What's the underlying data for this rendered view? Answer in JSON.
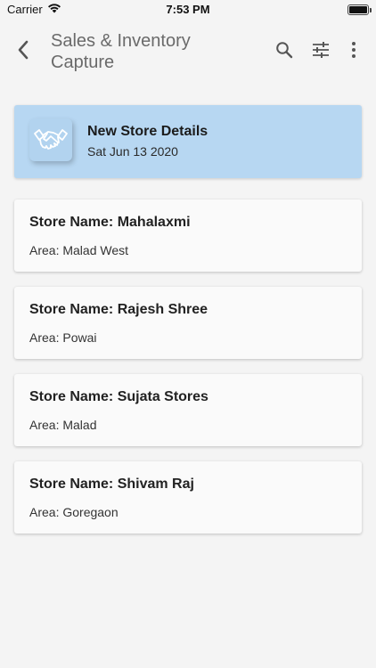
{
  "status_bar": {
    "carrier": "Carrier",
    "time": "7:53 PM",
    "icons": [
      "wifi-icon",
      "battery-icon"
    ]
  },
  "app_bar": {
    "title": "Sales & Inventory Capture",
    "back_icon": "back-arrow-icon",
    "actions": [
      "search-icon",
      "filter-sliders-icon",
      "more-vertical-icon"
    ],
    "title_color": "#6a6a6a"
  },
  "header_card": {
    "title": "New Store Details",
    "date": "Sat Jun 13 2020",
    "icon": "handshake-icon",
    "background": "#b7d7f2"
  },
  "stores": [
    {
      "name": "Store Name: Mahalaxmi",
      "area": "Area: Malad West"
    },
    {
      "name": "Store Name: Rajesh Shree",
      "area": "Area: Powai"
    },
    {
      "name": "Store Name: Sujata Stores",
      "area": "Area: Malad"
    },
    {
      "name": "Store Name: Shivam Raj",
      "area": "Area: Goregaon"
    }
  ]
}
